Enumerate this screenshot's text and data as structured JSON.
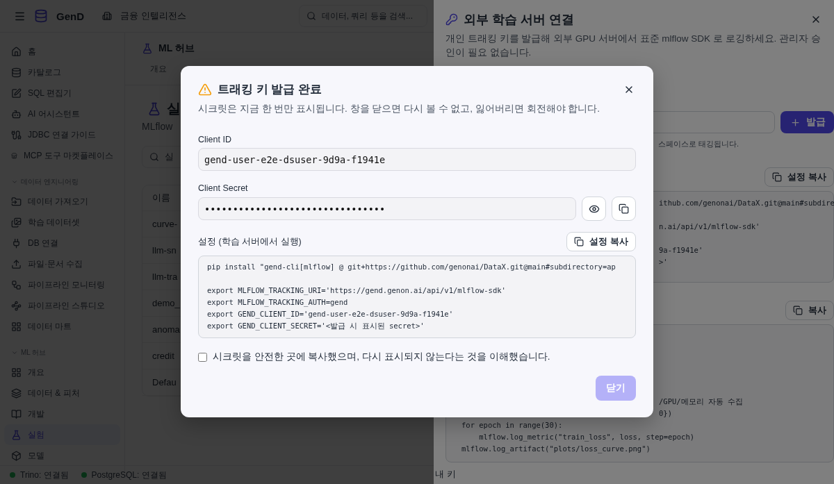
{
  "topbar": {
    "brand": "GenD",
    "workspace": "금융 인텔리전스",
    "search": {
      "placeholder": "데이터, 쿼리 등을 검색..."
    }
  },
  "sidebar": {
    "groups": [
      {
        "items": [
          {
            "label": "홈",
            "selected": false
          },
          {
            "label": "카탈로그",
            "selected": false
          },
          {
            "label": "SQL 편집기",
            "selected": false
          },
          {
            "label": "AI 어시스턴트",
            "selected": false
          },
          {
            "label": "JDBC 연결 가이드",
            "selected": false
          },
          {
            "label": "MCP 도구 마켓플레이스",
            "selected": false
          }
        ]
      },
      {
        "label": "데이터 엔지니어링",
        "expanded": true,
        "items": [
          {
            "label": "데이터 가져오기",
            "selected": false
          },
          {
            "label": "학습 데이터셋",
            "selected": false
          },
          {
            "label": "DB 연결",
            "selected": false
          },
          {
            "label": "파일·문서 수집",
            "selected": false
          },
          {
            "label": "파이프라인 모니터링",
            "selected": false
          },
          {
            "label": "파이프라인 스튜디오",
            "selected": false
          },
          {
            "label": "데이터 마트",
            "selected": false
          }
        ]
      },
      {
        "label": "ML 허브",
        "expanded": true,
        "items": [
          {
            "label": "개요",
            "selected": false
          },
          {
            "label": "데이터 & 피처",
            "selected": false
          },
          {
            "label": "개발",
            "selected": false
          },
          {
            "label": "실험",
            "selected": true
          },
          {
            "label": "모델",
            "selected": false
          }
        ]
      }
    ]
  },
  "main": {
    "header": "ML 허브",
    "tabs": [
      {
        "label": "개요",
        "selected": false
      }
    ],
    "page_title": "실",
    "subtitle": "MLflow",
    "search": {
      "placeholder": "실"
    },
    "table": {
      "columns": [
        "이름"
      ],
      "rows": [
        "curve-",
        "llm-sn",
        "llm-tra",
        "demo_",
        "anoma",
        "credit",
        "Defau"
      ]
    }
  },
  "status_bar": [
    {
      "label": "Trino: 연결됨",
      "connected": true
    },
    {
      "label": "PostgreSQL: 연결됨",
      "connected": true
    }
  ],
  "drawer": {
    "title": "외부 학습 서버 연결",
    "description": "개인 트래킹 키를 발급해 외부 GPU 서버에서 표준 mlflow SDK 로 로깅하세요. 관리자 승인이 필요 없습니다.",
    "issue_button": "발급",
    "hint": "스페이스로 태깅됩니다.",
    "copy_settings": "설정 복사",
    "code_1": [
      [
        "ithub.com/genonai/DataX.git@main#subdire"
      ],
      [
        "n.ai/api/v1/mlflow-sdk'"
      ],
      [
        "9a-f1941e'",
        ">'"
      ]
    ],
    "copy": "복사",
    "code_2": [
      {
        "text": "/GPU/메모리 자동 수집",
        "kind": "clipped"
      },
      {
        "text": "0})",
        "kind": "clipped"
      },
      {
        "text": "for epoch in range(30):",
        "kind": "plain"
      },
      {
        "text": "    mlflow.log_metric(\"train_loss\", loss, step=epoch)",
        "kind": "plain"
      },
      {
        "text": "mlflow.log_artifact(\"plots/loss_curve.png\")",
        "kind": "plain"
      }
    ],
    "section": "내 키"
  },
  "modal": {
    "title": "트래킹 키 발급 완료",
    "description": "시크릿은 지금 한 번만 표시됩니다. 창을 닫으면 다시 볼 수 없고, 잃어버리면 회전해야 합니다.",
    "client_id": {
      "label": "Client ID",
      "value": "gend-user-e2e-dsuser-9d9a-f1941e"
    },
    "client_secret": {
      "label": "Client Secret",
      "value": "••••••••••••••••••••••••••••••••"
    },
    "config": {
      "label": "설정 (학습 서버에서 실행)",
      "copy_button": "설정 복사",
      "blocks": [
        [
          "pip install \"gend-cli[mlflow] @ git+https://github.com/genonai/DataX.git@main#subdirectory=ap"
        ],
        [
          "export MLFLOW_TRACKING_URI='https://gend.genon.ai/api/v1/mlflow-sdk'",
          "export MLFLOW_TRACKING_AUTH=gend",
          "export GEND_CLIENT_ID='gend-user-e2e-dsuser-9d9a-f1941e'",
          "export GEND_CLIENT_SECRET='<발급 시 표시된 secret>'"
        ]
      ]
    },
    "confirm": {
      "label": "시크릿을 안전한 곳에 복사했으며, 다시 표시되지 않는다는 것을 이해했습니다.",
      "checked": false
    },
    "close_button": {
      "label": "닫기",
      "disabled": true
    }
  }
}
